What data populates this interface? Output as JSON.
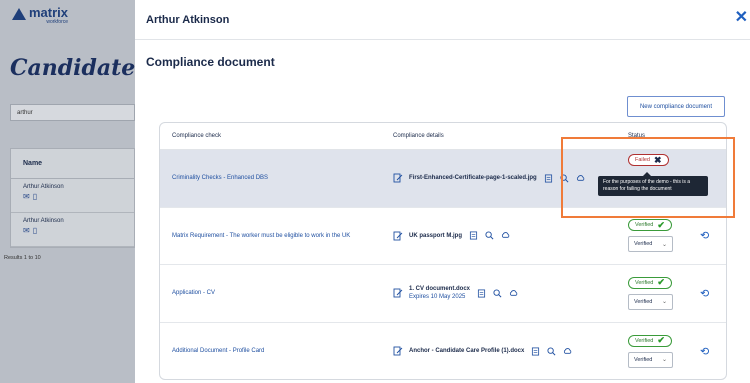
{
  "background": {
    "logo": {
      "name": "matrix",
      "sub": "workforce"
    },
    "heading": "Candidates",
    "search_value": "arthur",
    "table_header": "Name",
    "rows": [
      {
        "name": "Arthur Atkinson"
      },
      {
        "name": "Arthur Atkinson"
      }
    ],
    "results": "Results 1 to 10"
  },
  "drawer": {
    "title": "Arthur Atkinson",
    "close_icon": "close-x-icon",
    "section_title": "Compliance document",
    "new_button": "New compliance document",
    "columns": [
      "Compliance check",
      "Compliance details",
      "Status"
    ],
    "rows": [
      {
        "check": "Criminality Checks - Enhanced DBS",
        "file": "First-Enhanced-Certificate-page-1-scaled.jpg",
        "expires": "",
        "status": "Failed",
        "select": "",
        "highlight": true
      },
      {
        "check": "Matrix Requirement - The worker must be eligible to work in the UK",
        "file": "UK passport M.jpg",
        "expires": "",
        "status": "Verified",
        "select": "Verified"
      },
      {
        "check": "Application - CV",
        "file": "1. CV document.docx",
        "expires": "Expires 10 May 2025",
        "status": "Verified",
        "select": "Verified"
      },
      {
        "check": "Additional Document - Profile Card",
        "file": "Anchor - Candidate Care Profile (1).docx",
        "expires": "",
        "status": "Verified",
        "select": "Verified"
      }
    ],
    "tooltip": "For the purposes of the demo - this is a reason for failing the document"
  },
  "colors": {
    "accent": "#1f5fbf",
    "verified": "#2a9a2a",
    "failed": "#b03030",
    "annotation": "#f07b39"
  }
}
